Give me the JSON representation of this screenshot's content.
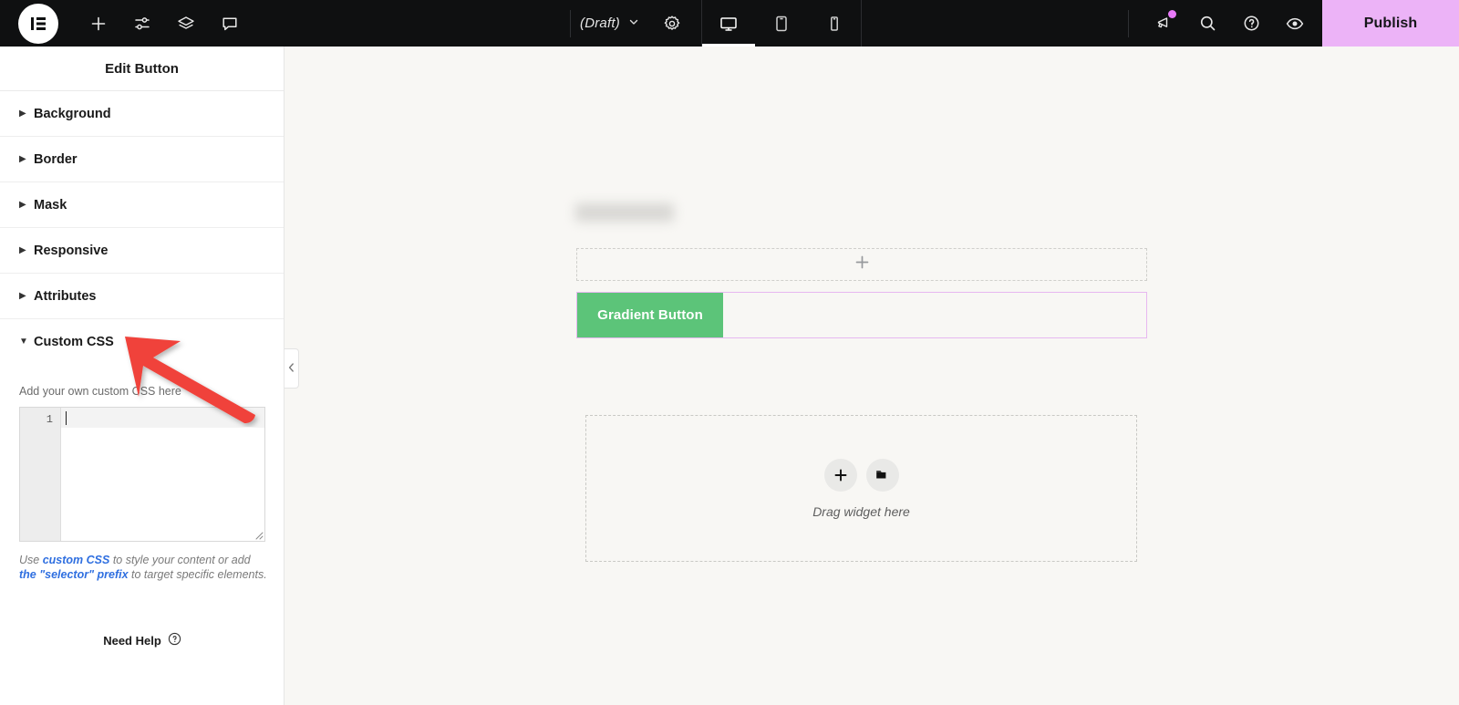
{
  "topbar": {
    "logo_icon": "elementor-logo-icon",
    "left_icons": [
      {
        "name": "add-element-icon",
        "label": "Add Element"
      },
      {
        "name": "site-settings-sliders-icon",
        "label": "Site Settings"
      },
      {
        "name": "layers-structure-icon",
        "label": "Structure"
      },
      {
        "name": "comments-bubble-icon",
        "label": "Comments"
      }
    ],
    "document_status": "(Draft)",
    "status_chevron": "chevron-down-icon",
    "settings_icon": "gear-icon",
    "devices": [
      {
        "name": "desktop",
        "icon": "desktop-icon",
        "active": true
      },
      {
        "name": "tablet",
        "icon": "tablet-icon",
        "active": false
      },
      {
        "name": "mobile",
        "icon": "mobile-icon",
        "active": false
      }
    ],
    "right_icons": [
      {
        "name": "megaphone-notifications-icon",
        "has_dot": true
      },
      {
        "name": "search-icon",
        "has_dot": false
      },
      {
        "name": "help-question-icon",
        "has_dot": false
      },
      {
        "name": "preview-eye-icon",
        "has_dot": false
      }
    ],
    "publish_label": "Publish",
    "publish_color": "#ecb3f7",
    "background_color": "#0f1011"
  },
  "panel": {
    "title": "Edit Button",
    "sections": [
      {
        "label": "Background",
        "expanded": false,
        "caret": "caret-right-icon"
      },
      {
        "label": "Border",
        "expanded": false,
        "caret": "caret-right-icon"
      },
      {
        "label": "Mask",
        "expanded": false,
        "caret": "caret-right-icon"
      },
      {
        "label": "Responsive",
        "expanded": false,
        "caret": "caret-right-icon"
      },
      {
        "label": "Attributes",
        "expanded": false,
        "caret": "caret-right-icon"
      },
      {
        "label": "Custom CSS",
        "expanded": true,
        "caret": "caret-down-icon"
      }
    ],
    "custom_css": {
      "hint": "Add your own custom CSS here",
      "line_number": "1",
      "code_value": "",
      "footnote_parts": [
        {
          "text": "Use ",
          "link": false
        },
        {
          "text": "custom CSS",
          "link": true
        },
        {
          "text": " to style your content or add ",
          "link": false
        },
        {
          "text": "the \"selector\" prefix",
          "link": true
        },
        {
          "text": " to target specific elements.",
          "link": false
        }
      ]
    },
    "need_help_label": "Need Help",
    "need_help_icon": "help-question-icon",
    "collapse_icon": "chevron-left-icon"
  },
  "canvas": {
    "background_color": "#f8f7f4",
    "add_section_icon": "plus-icon",
    "button_widget": {
      "label": "Gradient Button",
      "background_color": "#5cc479",
      "text_color": "#ffffff",
      "selection_border_color": "#e7b8f0"
    },
    "dropzone": {
      "add_icon": "plus-icon",
      "folder_icon": "folder-icon",
      "label": "Drag widget here"
    }
  },
  "annotation": {
    "arrow_color": "#f0433a",
    "points_to": "Custom CSS"
  }
}
